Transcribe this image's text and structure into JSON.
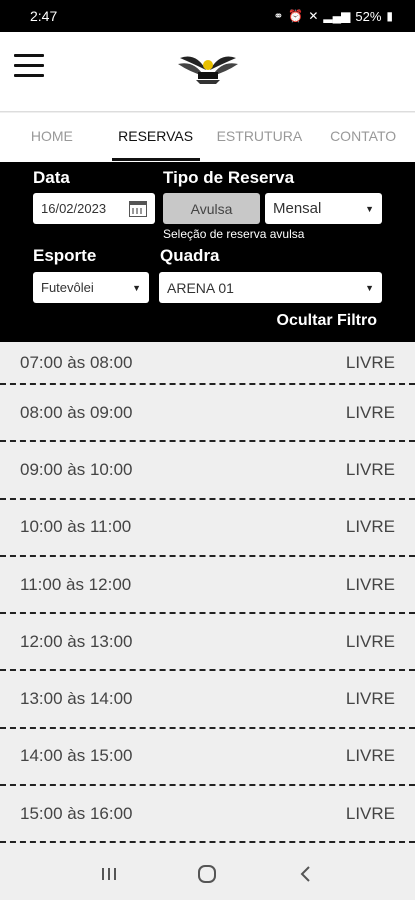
{
  "status": {
    "time": "2:47",
    "battery": "52%"
  },
  "tabs": [
    "HOME",
    "RESERVAS",
    "ESTRUTURA",
    "CONTATO"
  ],
  "filter": {
    "date_label": "Data",
    "date_value": "16/02/2023",
    "tipo_label": "Tipo de Reserva",
    "avulsa_label": "Avulsa",
    "mensal_value": "Mensal",
    "hint": "Seleção de reserva avulsa",
    "esporte_label": "Esporte",
    "esporte_value": "Futevôlei",
    "quadra_label": "Quadra",
    "quadra_value": "ARENA 01",
    "hide_label": "Ocultar Filtro"
  },
  "slots": [
    {
      "time": "07:00 às 08:00",
      "status": "LIVRE"
    },
    {
      "time": "08:00 às 09:00",
      "status": "LIVRE"
    },
    {
      "time": "09:00 às 10:00",
      "status": "LIVRE"
    },
    {
      "time": "10:00 às 11:00",
      "status": "LIVRE"
    },
    {
      "time": "11:00 às 12:00",
      "status": "LIVRE"
    },
    {
      "time": "12:00 às 13:00",
      "status": "LIVRE"
    },
    {
      "time": "13:00 às 14:00",
      "status": "LIVRE"
    },
    {
      "time": "14:00 às 15:00",
      "status": "LIVRE"
    },
    {
      "time": "15:00 às 16:00",
      "status": "LIVRE"
    }
  ]
}
